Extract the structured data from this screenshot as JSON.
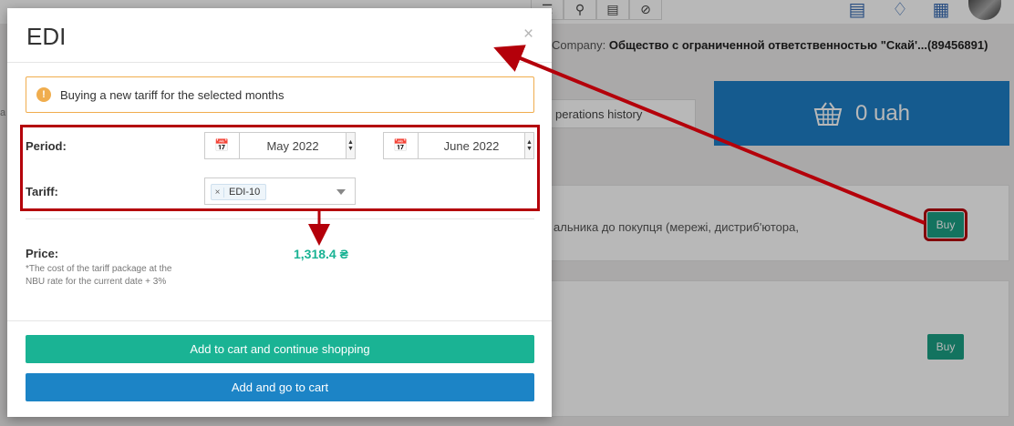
{
  "background": {
    "company_label": "Company:",
    "company_name": "Общество с ограниченной ответственностью \"Скай'...(89456891)",
    "operations_history": "perations history",
    "balance": "0 uah",
    "card1_text": "альника до покупця (мережі, дистриб'ютора,",
    "buy_label": "Buy"
  },
  "modal": {
    "title": "EDI",
    "close": "×",
    "alert_text": "Buying a new tariff for the selected months",
    "alert_icon": "!",
    "period_label": "Period:",
    "period_from": "May 2022",
    "period_to": "June 2022",
    "tariff_label": "Tariff:",
    "tariff_tag": "EDI-10",
    "tariff_tag_remove": "×",
    "price_label": "Price:",
    "price_note": "*The cost of the tariff package at the NBU rate for the current date + 3%",
    "price_value": "1,318.4 ₴",
    "btn_continue": "Add to cart and continue shopping",
    "btn_go_cart": "Add and go to cart"
  },
  "colors": {
    "green": "#1ab394",
    "blue": "#1c84c6",
    "annotation_red": "#b4000a",
    "alert_orange": "#f0ad4e"
  },
  "icons": [
    "list-icon",
    "search-icon",
    "save-icon",
    "block-icon",
    "news-icon",
    "bell-icon",
    "apps-icon",
    "calendar-icon",
    "basket-icon",
    "exclamation-icon"
  ]
}
